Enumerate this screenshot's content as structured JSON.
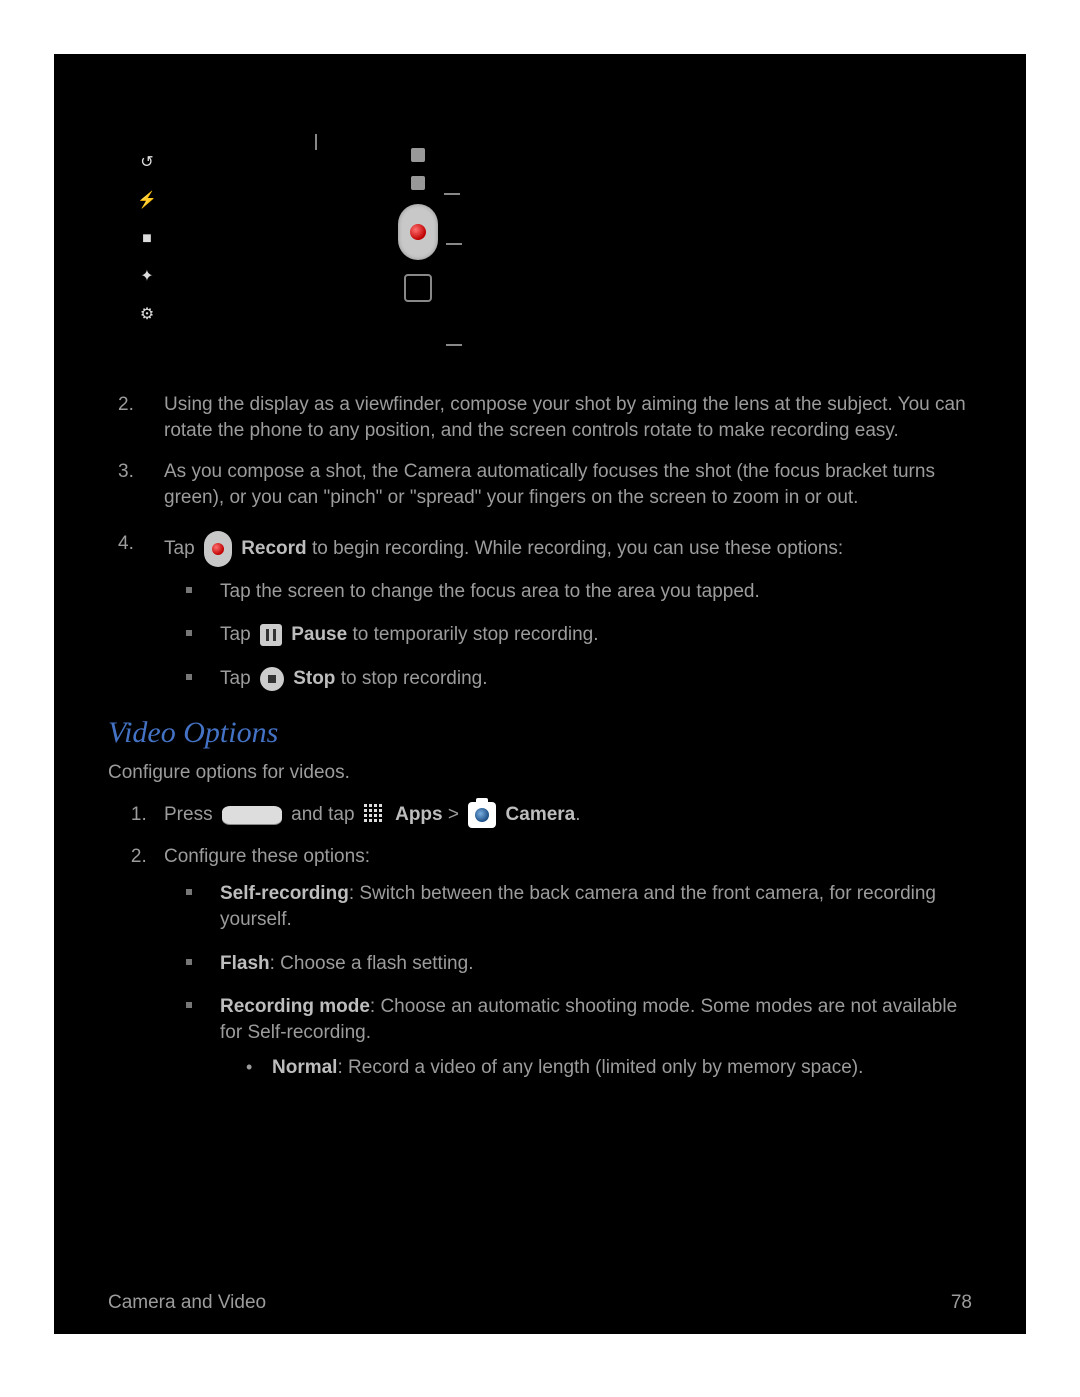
{
  "steps": {
    "s2": "Using the display as a viewfinder, compose your shot by aiming the lens at the subject. You can rotate the phone to any position, and the screen controls rotate to make recording easy.",
    "s3": "As you compose a shot, the Camera automatically focuses the shot (the focus bracket turns green), or you can \"pinch\" or \"spread\" your fingers on the screen to zoom in or out.",
    "s4_pre": "Tap ",
    "s4_bold": "Record",
    "s4_post": " to begin recording. While recording, you can use these options:",
    "s4_b1": "Tap the screen to change the focus area to the area you tapped.",
    "s4_b2_pre": "Tap ",
    "s4_b2_bold": "Pause",
    "s4_b2_post": " to temporarily stop recording.",
    "s4_b3_pre": "Tap ",
    "s4_b3_bold": "Stop",
    "s4_b3_post": " to stop recording."
  },
  "section2": {
    "heading": "Video Options",
    "intro": "Configure options for videos.",
    "s1_pre": "Press ",
    "s1_mid": " and tap ",
    "s1_apps": "Apps",
    "s1_gt": " > ",
    "s1_camera": "Camera",
    "s1_end": ".",
    "s2": "Configure these options:",
    "b1_bold": "Self-recording",
    "b1_rest": ": Switch between the back camera and the front camera, for recording yourself.",
    "b2_bold": "Flash",
    "b2_rest": ": Choose a flash setting.",
    "b3_bold": "Recording mode",
    "b3_rest": ": Choose an automatic shooting mode. Some modes are not available for Self-recording.",
    "b3_sub_bold": "Normal",
    "b3_sub_rest": ": Record a video of any length (limited only by memory space)."
  },
  "footer": {
    "left": "Camera and Video",
    "right": "78"
  }
}
